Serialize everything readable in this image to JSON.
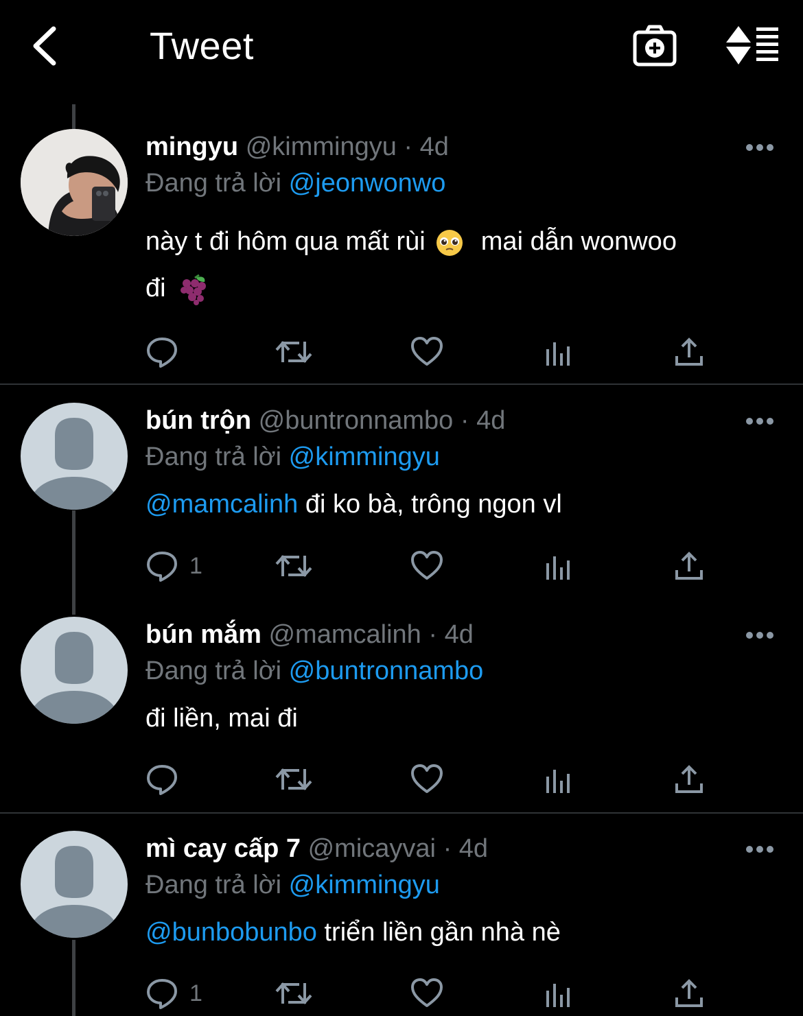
{
  "header": {
    "title": "Tweet",
    "back_icon": "chevron-left-icon",
    "camera_icon": "camera-add-icon",
    "sort_icon": "sort-list-icon"
  },
  "colors": {
    "background": "#000000",
    "text_primary": "#ffffff",
    "text_secondary": "#71767b",
    "link": "#1d9bf0",
    "divider": "#2f3336",
    "thread_line": "#3e4144",
    "avatar_default": "#ccd6dd",
    "avatar_silhouette": "#7b8a96"
  },
  "reply_prefix": "Đang trả lời",
  "tweets": [
    {
      "name": "mingyu",
      "handle": "@kimmingyu",
      "dot": "·",
      "time": "4d",
      "reply_to": "@jeonwonwo",
      "text_line1": "này t đi hôm qua mất rùi",
      "emoji1": "pleading-face-emoji",
      "text_line1b": "mai dẫn wonwoo",
      "text_line2": "đi",
      "emoji2": "grapes-emoji",
      "avatar": "photo-avatar",
      "reply_count": ""
    },
    {
      "name": "bún trộn",
      "handle": "@buntronnambo",
      "dot": "·",
      "time": "4d",
      "reply_to": "@kimmingyu",
      "mention": "@mamcalinh",
      "text": "đi ko bà, trông ngon vl",
      "avatar": "default-avatar",
      "reply_count": "1"
    },
    {
      "name": "bún mắm",
      "handle": "@mamcalinh",
      "dot": "·",
      "time": "4d",
      "reply_to": "@buntronnambo",
      "text": "đi liền, mai đi",
      "avatar": "default-avatar",
      "reply_count": ""
    },
    {
      "name": "mì cay cấp 7",
      "handle": "@micayvai",
      "dot": "·",
      "time": "4d",
      "reply_to": "@kimmingyu",
      "mention": "@bunbobunbo",
      "text": "triển liền gần nhà nè",
      "avatar": "default-avatar",
      "reply_count": "1"
    }
  ],
  "action_icons": [
    "reply-icon",
    "retweet-icon",
    "like-icon",
    "analytics-icon",
    "share-icon"
  ]
}
